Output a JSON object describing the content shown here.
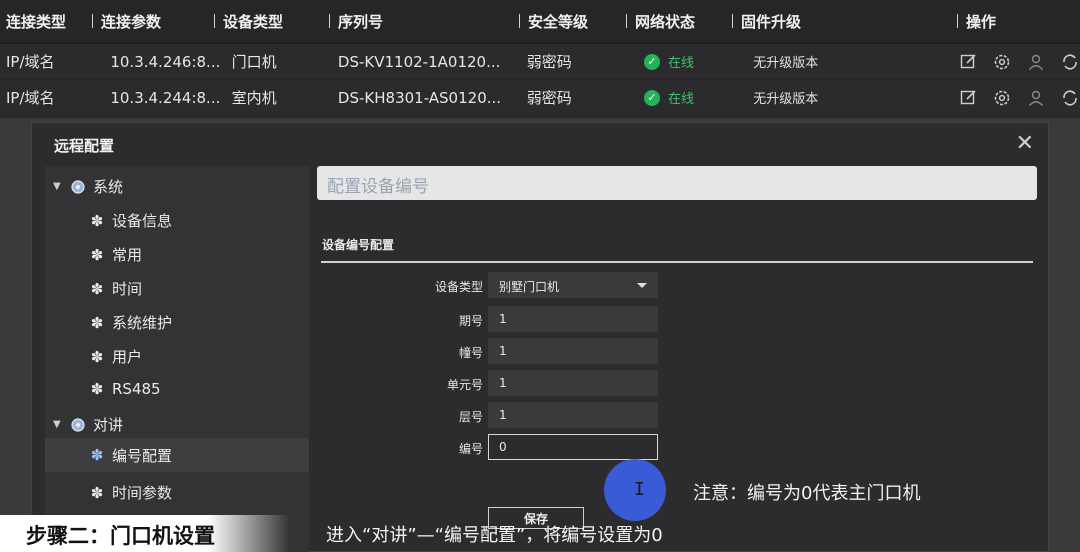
{
  "table": {
    "headers": [
      "连接类型",
      "连接参数",
      "设备类型",
      "序列号",
      "安全等级",
      "网络状态",
      "固件升级",
      "操作"
    ],
    "rows": [
      {
        "conn_type": "IP/域名",
        "conn_param": "10.3.4.246:8...",
        "device_type": "门口机",
        "serial": "DS-KV1102-1A0120...",
        "security": "弱密码",
        "status": "在线",
        "firmware": "无升级版本"
      },
      {
        "conn_type": "IP/域名",
        "conn_param": "10.3.4.244:8...",
        "device_type": "室内机",
        "serial": "DS-KH8301-AS0120...",
        "security": "弱密码",
        "status": "在线",
        "firmware": "无升级版本"
      }
    ],
    "op_icons": [
      "edit-icon",
      "settings-icon",
      "user-icon",
      "refresh-icon"
    ],
    "status_color": "#25b35a"
  },
  "dialog": {
    "title": "远程配置",
    "tree": {
      "system": "系统",
      "system_items": [
        "设备信息",
        "常用",
        "时间",
        "系统维护",
        "用户",
        "RS485"
      ],
      "intercom": "对讲",
      "intercom_items": [
        "编号配置",
        "时间参数"
      ],
      "selected": "编号配置"
    },
    "banner": "配置设备编号",
    "section": "设备编号配置",
    "form": {
      "device_type_label": "设备类型",
      "device_type_value": "别墅门口机",
      "period_label": "期号",
      "period_value": "1",
      "building_label": "幢号",
      "building_value": "1",
      "unit_label": "单元号",
      "unit_value": "1",
      "floor_label": "层号",
      "floor_value": "1",
      "number_label": "编号",
      "number_value": "0",
      "save_label": "保存"
    },
    "note": "注意：编号为0代表主门口机"
  },
  "caption": {
    "tag": "步骤二：门口机设置",
    "text": "进入“对讲”—“编号配置”，将编号设置为0"
  },
  "accent_color": "#3c5fe6"
}
